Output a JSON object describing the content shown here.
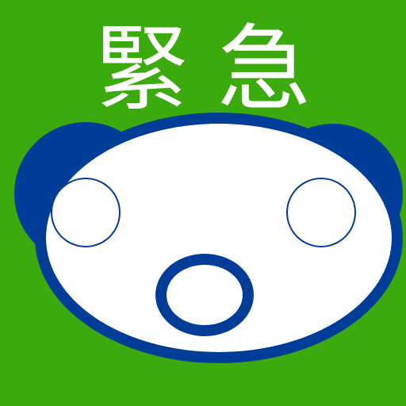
{
  "title": "緊急",
  "colors": {
    "background": "#3aaa0d",
    "outline": "#003d99",
    "face": "#ffffff",
    "title_text": "#ffffff"
  },
  "icons": {
    "mascot": "panda-face-icon"
  }
}
